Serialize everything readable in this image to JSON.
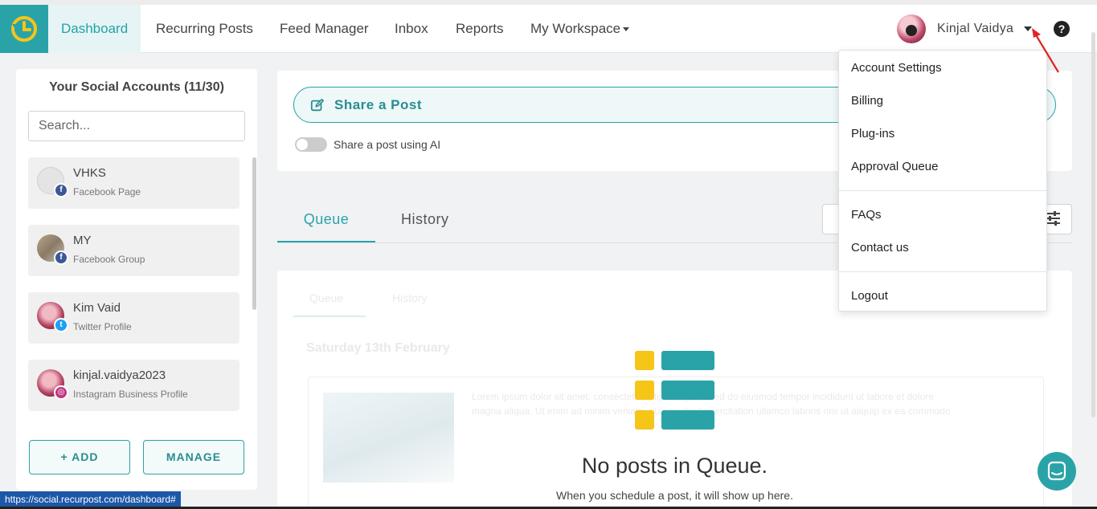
{
  "nav": {
    "items": [
      {
        "label": "Dashboard",
        "active": true
      },
      {
        "label": "Recurring Posts"
      },
      {
        "label": "Feed Manager"
      },
      {
        "label": "Inbox"
      },
      {
        "label": "Reports"
      },
      {
        "label": "My Workspace",
        "has_caret": true
      }
    ],
    "user_name": "Kinjal Vaidya",
    "help_glyph": "?"
  },
  "sidebar": {
    "title": "Your Social Accounts (11/30)",
    "search_placeholder": "Search...",
    "accounts": [
      {
        "name": "VHKS",
        "type": "Facebook Page",
        "network": "facebook"
      },
      {
        "name": "MY",
        "type": "Facebook Group",
        "network": "facebook"
      },
      {
        "name": "Kim Vaid",
        "type": "Twitter Profile",
        "network": "twitter"
      },
      {
        "name": "kinjal.vaidya2023",
        "type": "Instagram Business Profile",
        "network": "instagram"
      }
    ],
    "add_label": "ADD",
    "manage_label": "MANAGE"
  },
  "share": {
    "button_label": "Share a Post",
    "ai_toggle_label": "Share a post using AI",
    "ai_toggle_on": false
  },
  "tabs": [
    {
      "label": "Queue",
      "active": true
    },
    {
      "label": "History"
    }
  ],
  "queue": {
    "empty_title": "No posts in Queue.",
    "empty_subtitle": "When you schedule a post, it will show up here.",
    "ghost": {
      "tab_queue": "Queue",
      "tab_history": "History",
      "date": "Saturday 13th February",
      "lorem_1": "Lorem ipsum dolor sit amet, consectetur adipiscing elit, sed do eiusmod tempor incididunt ut labore et dolore",
      "lorem_2": "magna aliqua. Ut enim ad minim veniam, quis nostrud exercitation ullamco laboris nisi ut aliquip ex ea commodo"
    }
  },
  "dropdown": {
    "group1": [
      "Account Settings",
      "Billing",
      "Plug-ins",
      "Approval Queue"
    ],
    "group2": [
      "FAQs",
      "Contact us"
    ],
    "group3": [
      "Logout"
    ]
  },
  "status_bar_url": "https://social.recurpost.com/dashboard#",
  "colors": {
    "brand_teal": "#2aa3a8",
    "empty_icon_yellow": "#f5c518",
    "arrow_red": "#e02424",
    "status_blue": "#1c57a8"
  }
}
